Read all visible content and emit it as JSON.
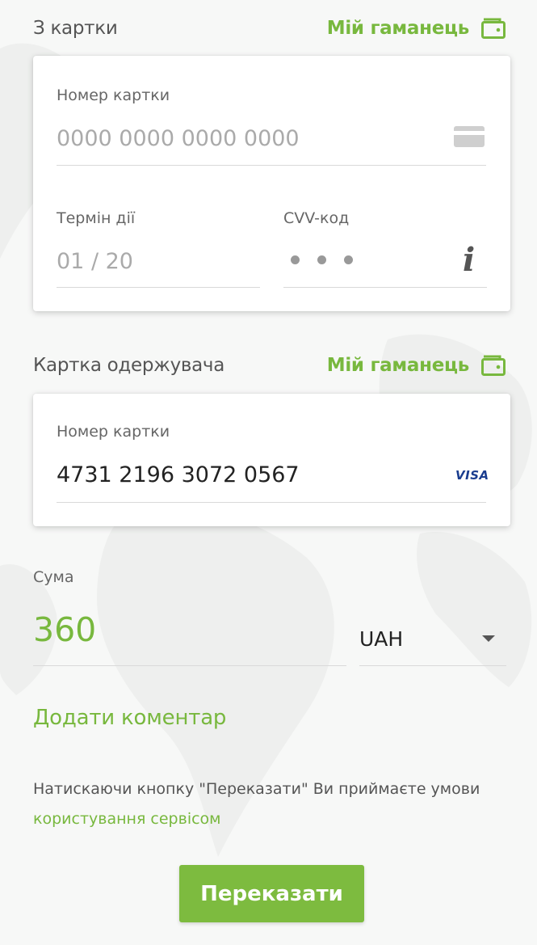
{
  "from_card": {
    "section_title": "З картки",
    "wallet_link": "Мій гаманець",
    "card_number_label": "Номер картки",
    "card_number_placeholder": "0000 0000 0000 0000",
    "expiry_label": "Термін дії",
    "expiry_placeholder": "01 / 20",
    "cvv_label": "CVV-код",
    "info_glyph": "i"
  },
  "to_card": {
    "section_title": "Картка одержувача",
    "wallet_link": "Мій гаманець",
    "card_number_label": "Номер картки",
    "card_number_value": "4731 2196 3072 0567",
    "card_brand": "VISA"
  },
  "amount": {
    "label": "Сума",
    "value": "360",
    "currency": "UAH"
  },
  "comment_link": "Додати коментар",
  "terms": {
    "text": "Натискаючи кнопку \"Переказати\" Ви приймаєте умови ",
    "link_text": "користування сервісом"
  },
  "submit_label": "Переказати",
  "colors": {
    "accent": "#78b83e",
    "button": "#7dbb3f",
    "visa": "#1a3d8f"
  }
}
